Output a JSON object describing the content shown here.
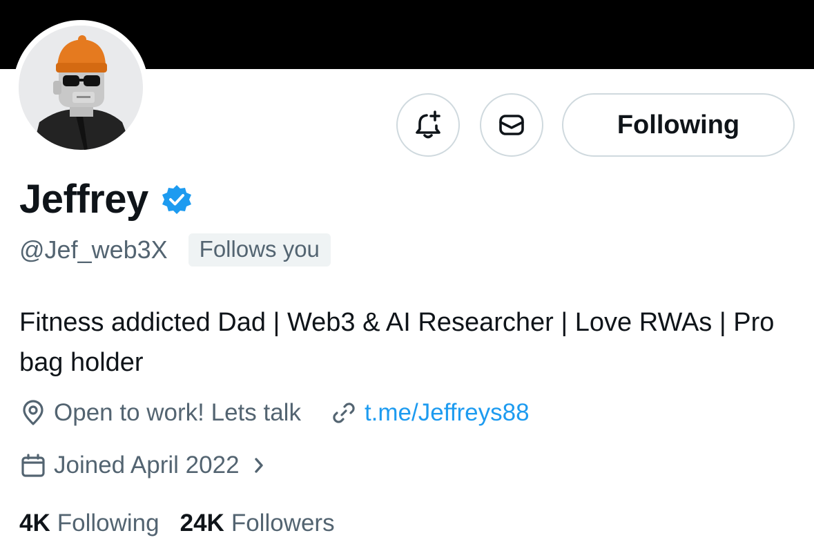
{
  "profile": {
    "display_name": "Jeffrey",
    "handle": "@Jef_web3X",
    "follows_you": "Follows you",
    "verified": true,
    "bio": "Fitness addicted Dad | Web3 & AI Researcher | Love RWAs | Pro bag holder",
    "location": "Open to work! Lets talk",
    "website": "t.me/Jeffreys88",
    "joined": "Joined April 2022"
  },
  "actions": {
    "notify_icon": "bell-plus-icon",
    "message_icon": "envelope-icon",
    "follow_label": "Following"
  },
  "stats": {
    "following_count": "4K",
    "following_label": "Following",
    "followers_count": "24K",
    "followers_label": "Followers"
  },
  "colors": {
    "banner": "#000000",
    "link": "#1d9bf0",
    "verified": "#1d9bf0",
    "secondary_text": "#536471",
    "border": "#cfd9de",
    "avatar_hat": "#e57a1f"
  }
}
